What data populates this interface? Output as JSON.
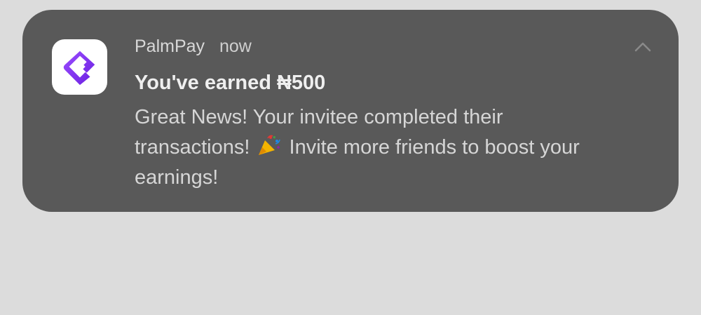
{
  "notification": {
    "app_name": "PalmPay",
    "time": "now",
    "title": "You've earned ₦500",
    "body_line_1": "Great News! Your invitee completed their",
    "body_line_2a": "transactions!",
    "body_line_2b": "Invite more friends to boost your",
    "body_line_3": "earnings!",
    "app_icon": "palmpay-logo-icon",
    "emoji_icon": "party-popper-icon",
    "collapse_icon": "chevron-up-icon"
  },
  "colors": {
    "background": "#dcdcdc",
    "card": "#595959",
    "brand": "#7b2ff7"
  }
}
